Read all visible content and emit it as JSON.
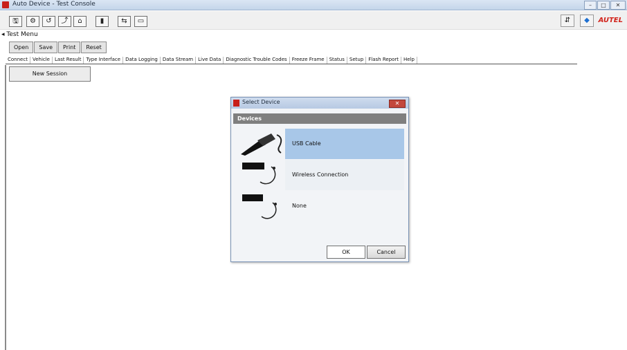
{
  "window": {
    "title": "Auto Device - Test Console",
    "controls": [
      "–",
      "□",
      "✕"
    ]
  },
  "toolbar": {
    "buttons": [
      "🖫",
      "⚙",
      "↺",
      "⤴",
      "⌂",
      "▮",
      "⇆",
      "▭"
    ],
    "right_buttons": [
      "⇵",
      "◆"
    ],
    "logo": "AUTEL"
  },
  "menu": {
    "text": "◂ Test Menu"
  },
  "tabs": [
    "Open",
    "Save",
    "Print",
    "Reset"
  ],
  "fields": [
    "Connect",
    "Vehicle",
    "Last Result",
    "Type Interface",
    "Data Logging",
    "Data Stream",
    "Live Data",
    "Diagnostic Trouble Codes",
    "Freeze Frame",
    "Status",
    "Setup",
    "Flash Report",
    "Help"
  ],
  "new_button": "New Session",
  "dialog": {
    "title": "Select Device",
    "header": "Devices",
    "options": [
      "USB Cable",
      "Wireless Connection",
      "None"
    ],
    "ok": "OK",
    "cancel": "Cancel",
    "close": "✕"
  }
}
